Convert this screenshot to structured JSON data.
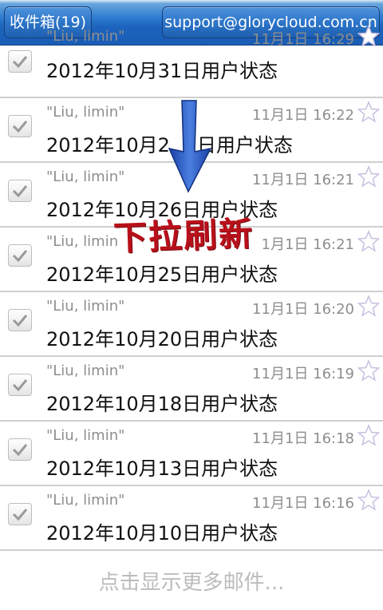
{
  "header": {
    "inbox_label": "收件箱(19)",
    "account_label": "support@glorycloud.com.cn"
  },
  "emails": [
    {
      "sender": "\"Liu, limin\"",
      "time": "11月1日 16:29",
      "subject": "2012年10月31日用户状态",
      "checked": true,
      "starred": false
    },
    {
      "sender": "\"Liu, limin\"",
      "time": "11月1日 16:22",
      "subject": "2012年10月2",
      "subject_tail": "日用户状态",
      "checked": true,
      "starred": false
    },
    {
      "sender": "\"Liu, limin\"",
      "time": "11月1日 16:21",
      "subject": "2012年10月26日用户状态",
      "checked": true,
      "starred": false
    },
    {
      "sender": "\"Liu, limin",
      "time": "1月1日 16:21",
      "subject": "2012年10月25日用户状态",
      "checked": true,
      "starred": false
    },
    {
      "sender": "\"Liu, limin\"",
      "time": "11月1日 16:20",
      "subject": "2012年10月20日用户状态",
      "checked": true,
      "starred": false
    },
    {
      "sender": "\"Liu, limin\"",
      "time": "11月1日 16:19",
      "subject": "2012年10月18日用户状态",
      "checked": true,
      "starred": false
    },
    {
      "sender": "\"Liu, limin\"",
      "time": "11月1日 16:18",
      "subject": "2012年10月13日用户状态",
      "checked": true,
      "starred": false
    },
    {
      "sender": "\"Liu, limin\"",
      "time": "11月1日 16:16",
      "subject": "2012年10月10日用户状态",
      "checked": true,
      "starred": false
    }
  ],
  "footer": {
    "load_more_label": "点击显示更多邮件..."
  },
  "overlay": {
    "pull_to_refresh_label": "下拉刷新",
    "arrow_icon": "down-arrow-icon",
    "arrow_color": "#2d5fd1",
    "label_color": "#b8101a"
  },
  "icons": {
    "checkbox": "checkmark-icon",
    "star": "star-outline-icon"
  }
}
